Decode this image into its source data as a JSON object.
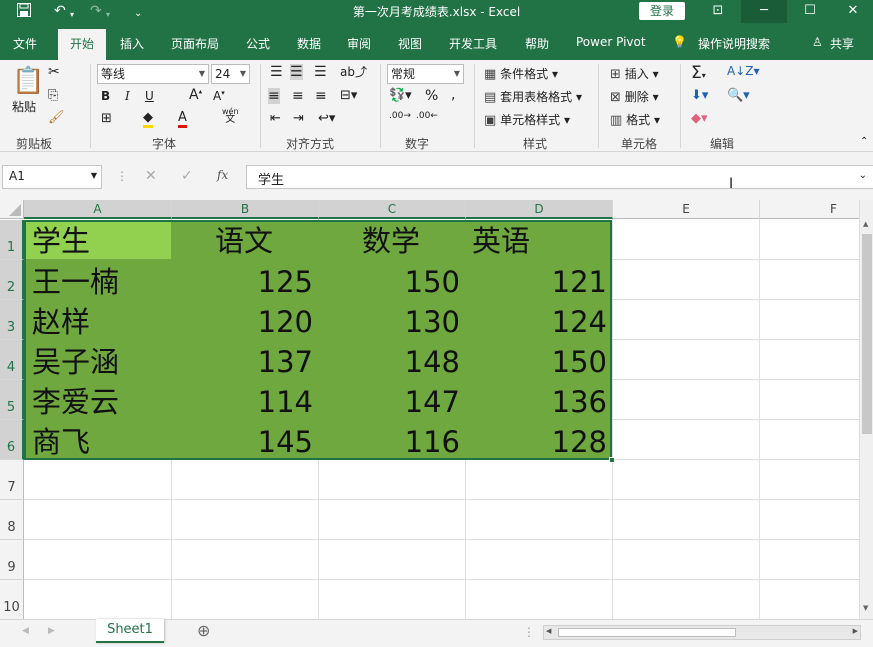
{
  "titlebar": {
    "save_icon": "save-icon",
    "undo_icon": "undo-icon",
    "redo_icon": "redo-icon",
    "title": "第一次月考成绩表.xlsx  -  Excel",
    "login": "登录",
    "min": "─",
    "restore": "☐",
    "close": "✕"
  },
  "tabs": [
    "文件",
    "开始",
    "插入",
    "页面布局",
    "公式",
    "数据",
    "审阅",
    "视图",
    "开发工具",
    "帮助",
    "Power Pivot",
    "操作说明搜索",
    "共享"
  ],
  "ribbon": {
    "paste": "粘贴",
    "clipboard": "剪贴板",
    "font_name": "等线",
    "font_size": "24",
    "font_group": "字体",
    "align_group": "对齐方式",
    "number_format": "常规",
    "number_group": "数字",
    "cond_format": "条件格式",
    "table_format": "套用表格格式",
    "cell_style": "单元格样式",
    "styles_group": "样式",
    "insert": "插入",
    "delete": "删除",
    "format": "格式",
    "cells_group": "单元格",
    "edit_group": "编辑",
    "wen": "wén"
  },
  "formula": {
    "namebox": "A1",
    "fx": "fx",
    "content": "学生"
  },
  "columns": [
    "A",
    "B",
    "C",
    "D",
    "E",
    "F"
  ],
  "rows": [
    "1",
    "2",
    "3",
    "4",
    "5",
    "6",
    "7",
    "8",
    "9",
    "10"
  ],
  "table": {
    "headers": [
      "学生",
      "语文",
      "数学",
      "英语"
    ],
    "data": [
      [
        "王一楠",
        "125",
        "150",
        "121"
      ],
      [
        "赵样",
        "120",
        "130",
        "124"
      ],
      [
        "吴子涵",
        "137",
        "148",
        "150"
      ],
      [
        "李爱云",
        "114",
        "147",
        "136"
      ],
      [
        "商飞",
        "145",
        "116",
        "128"
      ]
    ]
  },
  "sheet": {
    "name": "Sheet1",
    "add": "⊕"
  },
  "colors": {
    "accent": "#217346",
    "selection": "#70a840",
    "active_cell": "#92d050"
  }
}
